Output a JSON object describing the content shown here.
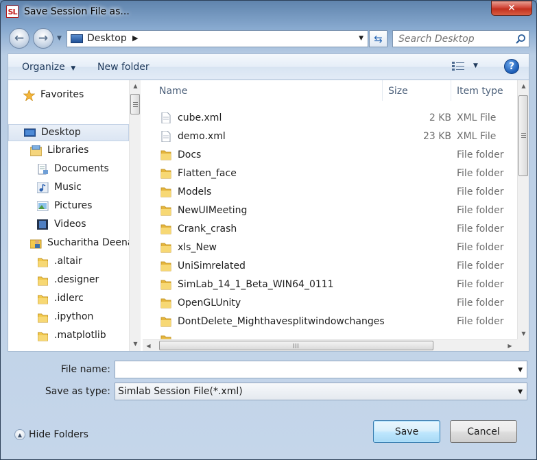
{
  "window": {
    "app_icon_text": "SL",
    "title": "Save Session File as...",
    "close_label": "✕"
  },
  "address_bar": {
    "location": "Desktop",
    "chevron": "▶",
    "refresh_glyph": "⇆"
  },
  "search": {
    "placeholder": "Search Desktop"
  },
  "toolbar": {
    "organize_label": "Organize",
    "organize_arrow": "▼",
    "new_folder_label": "New folder",
    "help_label": "?"
  },
  "nav_pane": {
    "items": [
      {
        "label": "Favorites",
        "icon": "star-icon"
      },
      {
        "label": "Desktop",
        "icon": "desktop-icon",
        "selected": true
      },
      {
        "label": "Libraries",
        "icon": "libraries-icon"
      },
      {
        "label": "Documents",
        "icon": "documents-icon"
      },
      {
        "label": "Music",
        "icon": "music-icon"
      },
      {
        "label": "Pictures",
        "icon": "pictures-icon"
      },
      {
        "label": "Videos",
        "icon": "videos-icon"
      },
      {
        "label": "Sucharitha Deena",
        "icon": "user-folder-icon"
      },
      {
        "label": ".altair",
        "icon": "folder-icon"
      },
      {
        "label": ".designer",
        "icon": "folder-icon"
      },
      {
        "label": ".idlerc",
        "icon": "folder-icon"
      },
      {
        "label": ".ipython",
        "icon": "folder-icon"
      },
      {
        "label": ".matplotlib",
        "icon": "folder-icon"
      }
    ]
  },
  "file_list": {
    "columns": {
      "name": "Name",
      "size": "Size",
      "type": "Item type"
    },
    "rows": [
      {
        "name": "cube.xml",
        "size": "2 KB",
        "type": "XML File",
        "icon": "xml-file-icon"
      },
      {
        "name": "demo.xml",
        "size": "23 KB",
        "type": "XML File",
        "icon": "xml-file-icon"
      },
      {
        "name": "Docs",
        "size": "",
        "type": "File folder",
        "icon": "folder-icon"
      },
      {
        "name": "Flatten_face",
        "size": "",
        "type": "File folder",
        "icon": "folder-icon"
      },
      {
        "name": "Models",
        "size": "",
        "type": "File folder",
        "icon": "folder-icon"
      },
      {
        "name": "NewUIMeeting",
        "size": "",
        "type": "File folder",
        "icon": "folder-icon"
      },
      {
        "name": "Crank_crash",
        "size": "",
        "type": "File folder",
        "icon": "folder-icon"
      },
      {
        "name": "xls_New",
        "size": "",
        "type": "File folder",
        "icon": "folder-icon"
      },
      {
        "name": "UniSimrelated",
        "size": "",
        "type": "File folder",
        "icon": "folder-icon"
      },
      {
        "name": "SimLab_14_1_Beta_WIN64_0111",
        "size": "",
        "type": "File folder",
        "icon": "folder-icon"
      },
      {
        "name": "OpenGLUnity",
        "size": "",
        "type": "File folder",
        "icon": "folder-icon"
      },
      {
        "name": "DontDelete_Mighthavesplitwindowchanges",
        "size": "",
        "type": "File folder",
        "icon": "folder-icon"
      }
    ]
  },
  "form": {
    "file_name_label": "File name:",
    "file_name_value": "",
    "save_type_label": "Save as type:",
    "save_type_value": "Simlab Session File(*.xml)"
  },
  "footer": {
    "hide_folders_label": "Hide Folders",
    "save_label": "Save",
    "cancel_label": "Cancel"
  },
  "colors": {
    "title_gradient_top": "#5f84ad",
    "folder_yellow": "#f2c94c",
    "save_button_blue": "#bee6fd"
  }
}
